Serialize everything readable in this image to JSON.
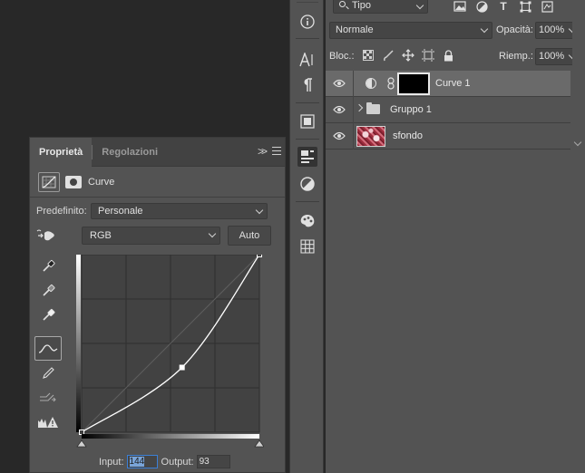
{
  "properties_panel": {
    "tabs": [
      {
        "label": "Proprietà",
        "active": true
      },
      {
        "label": "Regolazioni",
        "active": false
      }
    ],
    "collapse_label": ">>",
    "header_title": "Curve",
    "preset_label": "Predefinito:",
    "preset_value": "Personale",
    "channel_value": "RGB",
    "auto_label": "Auto",
    "input_label": "Input:",
    "input_value": "144",
    "output_label": "Output:",
    "output_value": "93",
    "tool_icons": [
      "sample-shadows-eyedropper-icon",
      "sample-gray-eyedropper-icon",
      "sample-highlights-eyedropper-icon",
      "curve-points-icon",
      "pencil-draw-icon",
      "smooth-curve-icon",
      "clipping-warning-icon"
    ]
  },
  "curve": {
    "points": [
      [
        0,
        0
      ],
      [
        144,
        93
      ],
      [
        255,
        255
      ]
    ],
    "range": [
      0,
      255
    ],
    "grid_divisions": 4
  },
  "toolstrip": {
    "icons": [
      "info-icon",
      "character-icon",
      "paragraph-icon",
      "layer-comps-icon",
      "properties-icon",
      "adjustments-icon",
      "styles-icon",
      "grid-icon"
    ],
    "selected": "properties-icon"
  },
  "layers_panel": {
    "filter_value": "Tipo",
    "filter_icons": [
      "image-filter-icon",
      "adjustment-filter-icon",
      "type-filter-icon",
      "shape-filter-icon",
      "smart-object-filter-icon"
    ],
    "type_filter_glyph": "T",
    "blend_mode": "Normale",
    "opacity_label": "Opacità:",
    "opacity_value": "100%",
    "lock_label": "Bloc.:",
    "lock_icons": [
      "lock-transparent-icon",
      "lock-image-icon",
      "lock-position-icon",
      "lock-artboard-icon",
      "lock-all-icon"
    ],
    "fill_label": "Riemp.:",
    "fill_value": "100%",
    "layers": [
      {
        "name": "Curve 1",
        "type": "adjustment",
        "selected": true
      },
      {
        "name": "Gruppo 1",
        "type": "group",
        "selected": false
      },
      {
        "name": "sfondo",
        "type": "image",
        "selected": false
      }
    ]
  },
  "colors": {
    "panel_bg": "#535353",
    "workspace_bg": "#282828",
    "input_focus": "#3b7fd6"
  }
}
